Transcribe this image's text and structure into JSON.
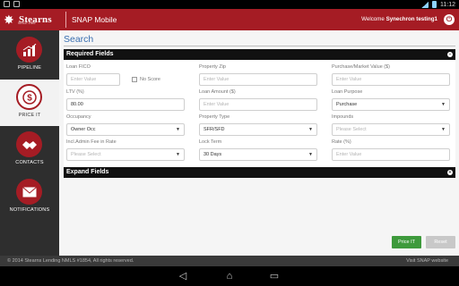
{
  "status_bar": {
    "time": "11:12"
  },
  "header": {
    "logo_text": "Stearns",
    "logo_subtext": "SINCE 1989",
    "app_title": "SNAP Mobile",
    "welcome_prefix": "Welcome",
    "welcome_user": "Synechron testing1",
    "brand_color": "#a51c24"
  },
  "sidebar": {
    "items": [
      {
        "label": "PIPELINE",
        "icon": "bar-chart-icon",
        "active": false
      },
      {
        "label": "PRICE IT",
        "icon": "dollar-refresh-icon",
        "active": true
      },
      {
        "label": "CONTACTS",
        "icon": "handshake-icon",
        "active": false
      },
      {
        "label": "NOTIFICATIONS",
        "icon": "envelope-icon",
        "active": false
      }
    ]
  },
  "main": {
    "title": "Search",
    "required_label": "Required Fields",
    "expand_label": "Expand Fields",
    "fields": {
      "loan_fico": {
        "label": "Loan FICO",
        "placeholder": "Enter Value"
      },
      "no_score": {
        "label": "No Score"
      },
      "property_zip": {
        "label": "Property Zip",
        "placeholder": "Enter Value"
      },
      "purchase_value": {
        "label": "Purchase/Market Value ($)",
        "placeholder": "Enter Value"
      },
      "ltv": {
        "label": "LTV (%)",
        "value": "80.00"
      },
      "loan_amount": {
        "label": "Loan Amount ($)",
        "placeholder": "Enter Value"
      },
      "loan_purpose": {
        "label": "Loan Purpose",
        "value": "Purchase"
      },
      "occupancy": {
        "label": "Occupancy",
        "value": "Owner Occ"
      },
      "property_type": {
        "label": "Property Type",
        "value": "SFR/SFD"
      },
      "impounds": {
        "label": "Impounds",
        "placeholder": "Please Select"
      },
      "incl_admin_fee": {
        "label": "Incl.Admin Fee in Rate",
        "placeholder": "Please Select"
      },
      "lock_term": {
        "label": "Lock Term",
        "value": "30 Days"
      },
      "rate": {
        "label": "Rate (%)",
        "placeholder": "Enter Value"
      }
    },
    "buttons": {
      "price_it": "Price IT",
      "reset": "Reset"
    }
  },
  "footer": {
    "copyright": "© 2014 Stearns Lending NMLS #1854, All rights reserved.",
    "visit_link": "Visit SNAP website"
  }
}
